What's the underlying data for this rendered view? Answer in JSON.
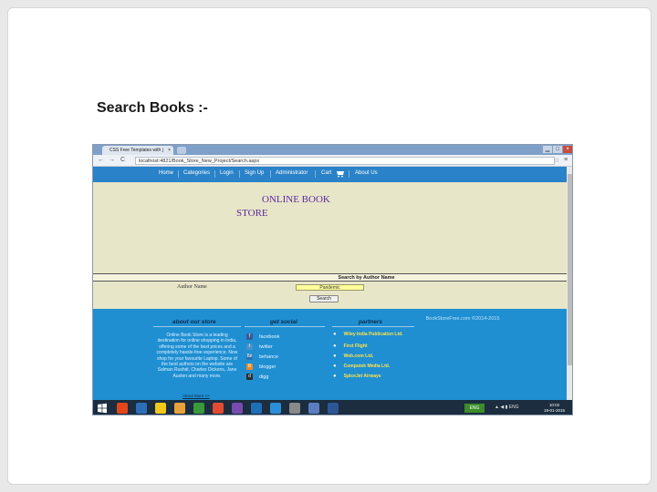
{
  "slide": {
    "title": "Search Books :-"
  },
  "browser": {
    "tab_title": "CSS Free Templates with j",
    "tab_close": "×",
    "window_controls": [
      "▁",
      "□",
      "×"
    ],
    "nav_glyphs": {
      "back": "←",
      "forward": "→",
      "reload": "C"
    },
    "address": "localhost:4821/Book_Store_New_Project/Search.aspx",
    "star": "☆",
    "menu": "≡"
  },
  "site": {
    "nav": [
      "Home",
      "Categories",
      "Login",
      "Sign Up",
      "Administrator",
      "Cart",
      "About Us"
    ],
    "hero_title_line1": "ONLINE BOOK",
    "hero_title_line2": "STORE",
    "search_header": "Search by Author Name",
    "author_label": "Author Name",
    "author_value": "Pandemic",
    "search_button": "Search",
    "footer": {
      "about_heading": "about our store",
      "social_heading": "get social",
      "partners_heading": "partners",
      "about_text": "Online Book Store is a leading destination for online shopping in India, offering some of the best prices and a completely hassle-free experience. Now shop for your favourite Laptop. Some of the best authors on the website are Salman Rushdi, Charles Dickens, Jane Austen and many more.",
      "about_link": "About More >>",
      "social": [
        {
          "label": "facebook",
          "glyph": "f",
          "color": "#3b5998"
        },
        {
          "label": "twitter",
          "glyph": "t",
          "color": "#4a90c8"
        },
        {
          "label": "behance",
          "glyph": "Bē",
          "color": "#2a6fb0"
        },
        {
          "label": "blogger",
          "glyph": "B",
          "color": "#f08a24"
        },
        {
          "label": "digg",
          "glyph": "d",
          "color": "#2c2c2c"
        }
      ],
      "partners": [
        "Wiley India Publication Ltd.",
        "First Flight",
        "Web.com Ltd.",
        "Computek Media Ltd.",
        "SpiceJet Airways"
      ],
      "copyright": "BookStoreFree.com ©2014-2015",
      "bullet": "●"
    }
  },
  "taskbar": {
    "tray_label": "ENG",
    "tray_icons": "▲ ◀ ▮ ENG",
    "time": "10:02",
    "date": "19-01-2015",
    "app_colors": [
      "#e3461a",
      "#2c6fb8",
      "#f2c81c",
      "#e8a23a",
      "#3a9a3a",
      "#e34a32",
      "#7a4ab0",
      "#1e6fb5",
      "#2a8fd8",
      "#8a8a8a",
      "#5a7ec0",
      "#2b5797"
    ]
  }
}
